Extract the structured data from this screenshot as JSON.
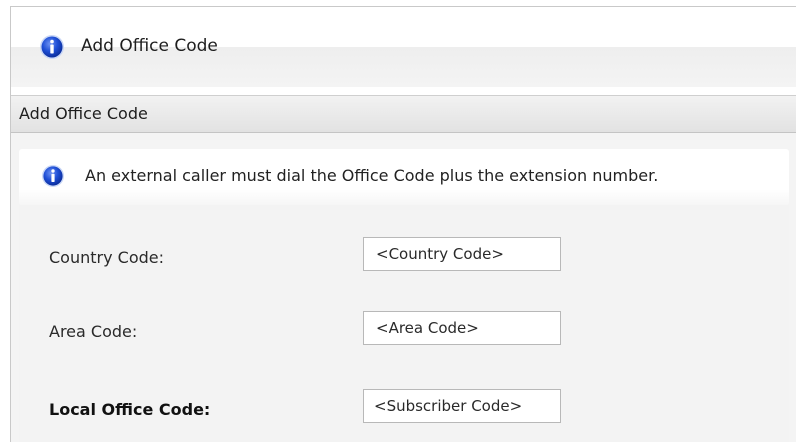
{
  "window": {
    "title": "Add Office Code",
    "title_icon": "info-icon"
  },
  "section": {
    "header": "Add Office Code"
  },
  "info": {
    "icon": "info-icon",
    "message": "An external caller must dial the Office Code plus the extension number."
  },
  "form": {
    "country_code": {
      "label": "Country Code:",
      "value": "",
      "placeholder": "<Country Code>"
    },
    "area_code": {
      "label": "Area Code:",
      "value": "",
      "placeholder": "<Area Code>"
    },
    "local_office_code": {
      "label": "Local Office Code:",
      "value": "",
      "placeholder": "<Subscriber Code>"
    }
  },
  "colors": {
    "info_icon_fill": "#1a4fd8",
    "info_icon_ring": "#9fb8f0"
  }
}
